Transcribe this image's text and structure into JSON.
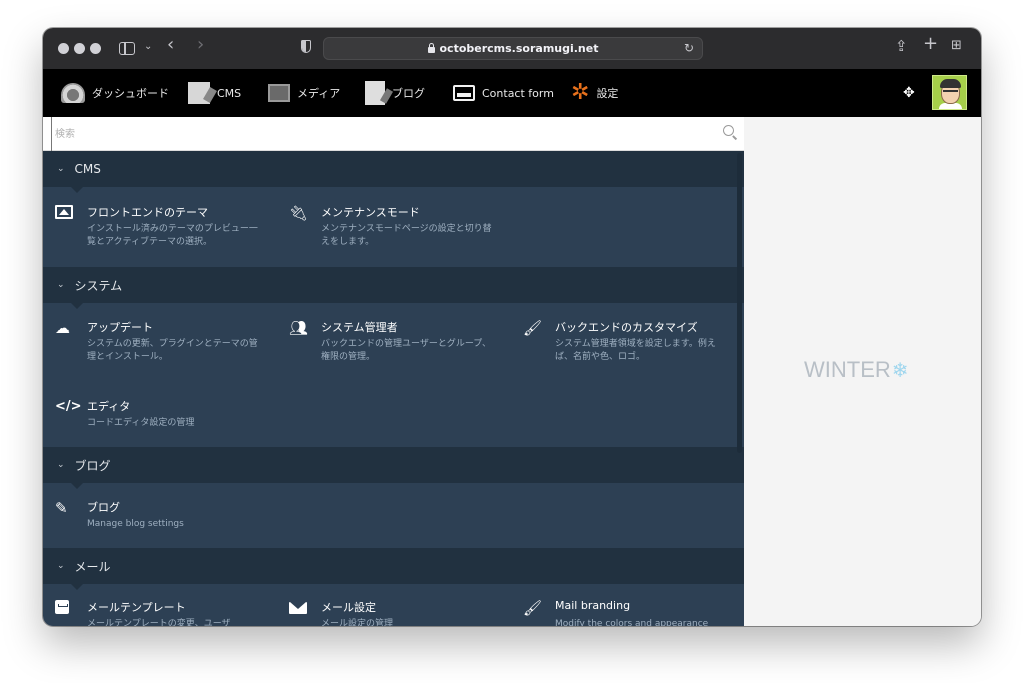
{
  "browser": {
    "url": "octobercms.soramugi.net"
  },
  "topnav": {
    "items": [
      {
        "label": "ダッシュボード",
        "icon": "dashboard-icon"
      },
      {
        "label": "CMS",
        "icon": "cms-icon"
      },
      {
        "label": "メディア",
        "icon": "media-icon"
      },
      {
        "label": "ブログ",
        "icon": "blog-icon"
      },
      {
        "label": "Contact form",
        "icon": "contact-form-icon"
      },
      {
        "label": "設定",
        "icon": "settings-gear-icon"
      }
    ]
  },
  "search": {
    "placeholder": "検索"
  },
  "sections": [
    {
      "title": "CMS",
      "items": [
        {
          "title": "フロントエンドのテーマ",
          "desc": "インストール済みのテーマのプレビュー一覧とアクティブテーマの選択。",
          "icon": "image-icon"
        },
        {
          "title": "メンテナンスモード",
          "desc": "メンテナンスモードページの設定と切り替えをします。",
          "icon": "plug-icon"
        }
      ]
    },
    {
      "title": "システム",
      "items": [
        {
          "title": "アップデート",
          "desc": "システムの更新、プラグインとテーマの管理とインストール。",
          "icon": "cloud-download-icon"
        },
        {
          "title": "システム管理者",
          "desc": "バックエンドの管理ユーザーとグループ、権限の管理。",
          "icon": "users-icon"
        },
        {
          "title": "バックエンドのカスタマイズ",
          "desc": "システム管理者領域を設定します。例えば、名前や色、ロゴ。",
          "icon": "paintbrush-icon"
        },
        {
          "title": "エディタ",
          "desc": "コードエディタ設定の管理",
          "icon": "code-icon"
        }
      ]
    },
    {
      "title": "ブログ",
      "items": [
        {
          "title": "ブログ",
          "desc": "Manage blog settings",
          "icon": "pencil-icon"
        }
      ]
    },
    {
      "title": "メール",
      "items": [
        {
          "title": "メールテンプレート",
          "desc": "メールテンプレートの変更、ユーザ",
          "icon": "mail-template-icon"
        },
        {
          "title": "メール設定",
          "desc": "メール設定の管理",
          "icon": "envelope-icon"
        },
        {
          "title": "Mail branding",
          "desc": "Modify the colors and appearance",
          "icon": "paintbrush-icon"
        }
      ]
    }
  ],
  "brand": {
    "text": "WINTER",
    "accent": "#9fd6ee"
  },
  "colors": {
    "nav_bg": "#000000",
    "content_bg": "#2d4054",
    "section_bg": "#213140",
    "settings_accent": "#e8711c"
  }
}
